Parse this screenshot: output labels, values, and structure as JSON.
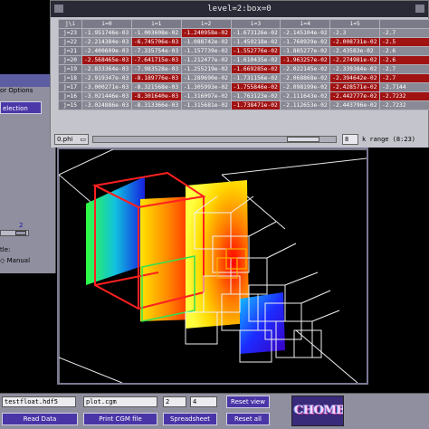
{
  "left_panel": {
    "options_label": "or Options",
    "selection_button": "election",
    "value_2": "2",
    "style_label": "tle:",
    "manual_label": "Manual"
  },
  "sheet": {
    "title": "level=2:box=0",
    "headers": [
      "j\\i",
      "i=0",
      "i=1",
      "i=2",
      "i=3",
      "i=4",
      "i=5"
    ],
    "rows": [
      {
        "label": "j=23",
        "cells": [
          "-1.951746e-03",
          "-1.003608e-02",
          "-1.240958e-02",
          "-1.673126e-02",
          "-2.145104e-02",
          "-2.3"
        ],
        "red": [
          false,
          false,
          true,
          false,
          false,
          false
        ]
      },
      {
        "label": "j=22",
        "cells": [
          "-2.214384e-03",
          "-6.745706e-03",
          "-1.088742e-02",
          "-1.459218e-02",
          "-1.768929e-02",
          "-2.008731e-02"
        ],
        "red": [
          false,
          true,
          false,
          false,
          false,
          true
        ]
      },
      {
        "label": "j=21",
        "cells": [
          "-2.400609e-03",
          "-7.335754e-03",
          "-1.157739e-02",
          "-1.552776e-02",
          "-1.885277e-02",
          "-2.43583e-02"
        ],
        "red": [
          false,
          false,
          false,
          true,
          false,
          false
        ]
      },
      {
        "label": "j=20",
        "cells": [
          "-2.568465e-03",
          "-7.641715e-03",
          "-1.212477e-02",
          "-1.610435e-02",
          "-1.963257e-02",
          "-2.274981e-02"
        ],
        "red": [
          true,
          true,
          false,
          false,
          true,
          true
        ]
      },
      {
        "label": "j=19",
        "cells": [
          "-2.833364e-03",
          "-7.983528e-03",
          "-1.255219e-02",
          "-1.669285e-02",
          "-2.022145e-02",
          "-2.339384e-02"
        ],
        "red": [
          false,
          false,
          false,
          true,
          false,
          false
        ]
      },
      {
        "label": "j=18",
        "cells": [
          "-2.919347e-03",
          "-8.189776e-03",
          "-1.289690e-02",
          "-1.731156e-02",
          "-2.068868e-02",
          "-2.394642e-02"
        ],
        "red": [
          false,
          true,
          false,
          false,
          false,
          true
        ]
      },
      {
        "label": "j=17",
        "cells": [
          "-3.000271e-03",
          "-8.321568e-03",
          "-1.305993e-02",
          "-1.755846e-02",
          "-2.098199e-02",
          "-2.428571e-02"
        ],
        "red": [
          false,
          false,
          false,
          true,
          false,
          true
        ]
      },
      {
        "label": "j=16",
        "cells": [
          "-3.021446e-03",
          "-8.301640e-03",
          "-1.316097e-02",
          "-1.763123e-02",
          "-2.111643e-02",
          "-2.442777e-02"
        ],
        "red": [
          false,
          true,
          false,
          false,
          false,
          true
        ]
      },
      {
        "label": "j=15",
        "cells": [
          "-3.024886e-03",
          "-8.313366e-03",
          "-1.315681e-02",
          "-1.738471e-02",
          "-2.112653e-02",
          "-2.443796e-02"
        ],
        "red": [
          false,
          false,
          false,
          true,
          false,
          false
        ]
      }
    ],
    "extra_col": [
      "-2.7",
      "-2.5",
      "-2.6",
      "-2.6",
      "-2.7",
      "-2.7",
      "-2.7144",
      "-2.7232",
      "-2.7232"
    ],
    "variable": "0.phi",
    "k_value": "8",
    "k_range": "k range (8:23)"
  },
  "bottom": {
    "file_field": "testfloat.hdf5",
    "cgm_field": "plot.cgm",
    "field_a": "2",
    "field_b": "4",
    "read_data": "Read Data",
    "print_cgm": "Print CGM file",
    "spreadsheet": "Spreadsheet",
    "reset_view": "Reset view",
    "reset_all": "Reset all",
    "logo": "CHOMBO"
  },
  "colors": {
    "button_bg": "#4a35a6",
    "panel_bg": "#8f8fa0",
    "cell_red": "#a11313",
    "cell_gray": "#8a8a96"
  }
}
